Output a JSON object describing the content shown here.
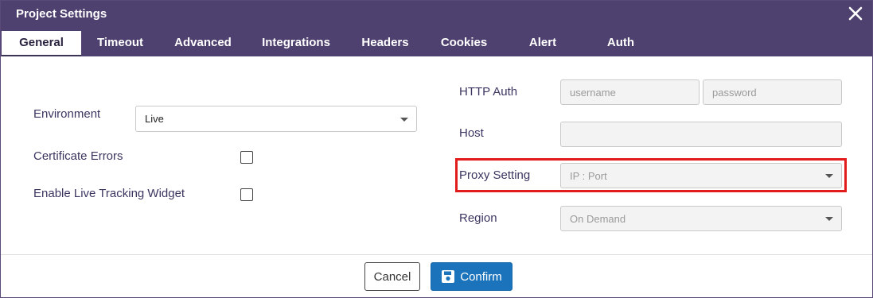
{
  "dialog": {
    "title": "Project Settings",
    "close_icon": "close-icon"
  },
  "tabs": [
    {
      "label": "General",
      "active": true
    },
    {
      "label": "Timeout"
    },
    {
      "label": "Advanced"
    },
    {
      "label": "Integrations"
    },
    {
      "label": "Headers"
    },
    {
      "label": "Cookies"
    },
    {
      "label": "Alert"
    },
    {
      "label": "Auth"
    }
  ],
  "left": {
    "environment_label": "Environment",
    "environment_value": "Live",
    "cert_errors_label": "Certificate Errors",
    "cert_errors_checked": false,
    "live_tracking_label": "Enable Live Tracking Widget",
    "live_tracking_checked": false
  },
  "right": {
    "http_auth_label": "HTTP Auth",
    "username_placeholder": "username",
    "password_placeholder": "password",
    "host_label": "Host",
    "host_value": "",
    "proxy_label": "Proxy Setting",
    "proxy_placeholder": "IP : Port",
    "region_label": "Region",
    "region_value": "On Demand"
  },
  "footer": {
    "cancel_label": "Cancel",
    "confirm_label": "Confirm",
    "confirm_icon": "save-icon"
  },
  "colors": {
    "header_bg": "#4f416f",
    "highlight": "#e21b1b",
    "confirm_bg": "#1a73bb"
  }
}
